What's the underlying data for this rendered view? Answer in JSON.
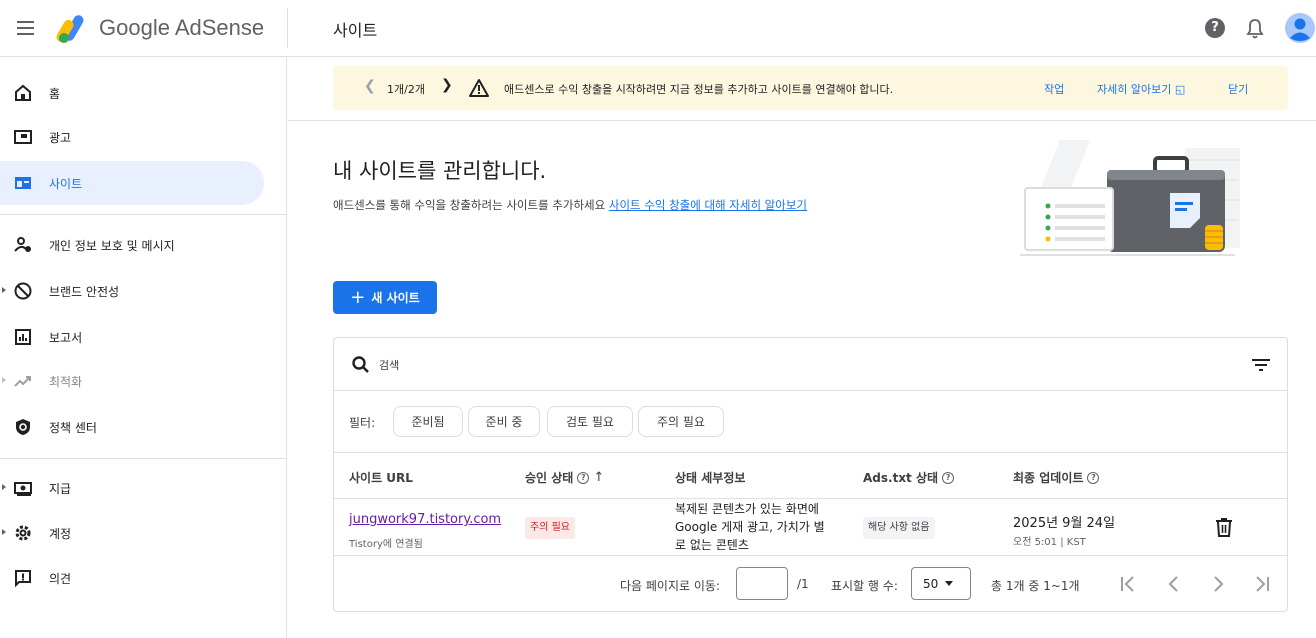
{
  "topbar": {
    "brand": "Google AdSense",
    "page_title": "사이트",
    "help_label": "?"
  },
  "sidebar": {
    "items": [
      {
        "label": "홈",
        "icon": "home-icon"
      },
      {
        "label": "광고",
        "icon": "ads-icon"
      },
      {
        "label": "사이트",
        "icon": "sites-icon",
        "active": true
      },
      {
        "label": "개인 정보 보호 및 메시지",
        "icon": "privacy-messaging-icon"
      },
      {
        "label": "브랜드 안전성",
        "icon": "block-icon"
      },
      {
        "label": "보고서",
        "icon": "report-icon"
      },
      {
        "label": "최적화",
        "icon": "trending-icon"
      },
      {
        "label": "정책 센터",
        "icon": "policy-icon"
      },
      {
        "label": "지급",
        "icon": "payments-icon"
      },
      {
        "label": "계정",
        "icon": "settings-icon"
      },
      {
        "label": "의견",
        "icon": "feedback-icon"
      }
    ]
  },
  "banner": {
    "page_indicator": "1개/2개",
    "message": "애드센스로 수익 창출을 시작하려면 지금 정보를 추가하고 사이트를 연결해야 합니다.",
    "action_label": "작업",
    "learn_more_label": "자세히 알아보기",
    "close_label": "닫기"
  },
  "main": {
    "heading": "내 사이트를 관리합니다.",
    "subtext": "애드센스를 통해 수익을 창출하려는 사이트를 추가하세요",
    "subtext_link": "사이트 수익 창출에 대해 자세히 알아보기",
    "new_site_label": "새 사이트"
  },
  "table": {
    "search_placeholder": "검색",
    "filter_label": "필터:",
    "filters": [
      "준비됨",
      "준비 중",
      "검토 필요",
      "주의 필요"
    ],
    "columns": [
      "사이트 URL",
      "승인 상태",
      "상태 세부정보",
      "Ads.txt 상태",
      "최종 업데이트"
    ],
    "rows": [
      {
        "url": "jungwork97.tistory.com",
        "url_sub": "Tistory에 연결됨",
        "approval": "주의 필요",
        "detail": "복제된 콘텐츠가 있는 화면에 Google 게재 광고, 가치가 별로 없는 콘텐츠",
        "ads_txt": "해당 사항 없음",
        "updated_date": "2025년 9월 24일",
        "updated_time": "오전 5:01 | KST"
      }
    ],
    "footer": {
      "go_to_page": "다음 페이지로 이동:",
      "page_value": "",
      "page_total": "/1",
      "rows_per_page_label": "표시할 행 수:",
      "rows_per_page": "50",
      "total": "총 1개 중 1~1개"
    }
  },
  "colors": {
    "accent": "#1a73e8",
    "banner_bg": "#fef7e0",
    "warning_badge": "#fce8e6",
    "active_nav_bg": "#e8f0fe"
  }
}
